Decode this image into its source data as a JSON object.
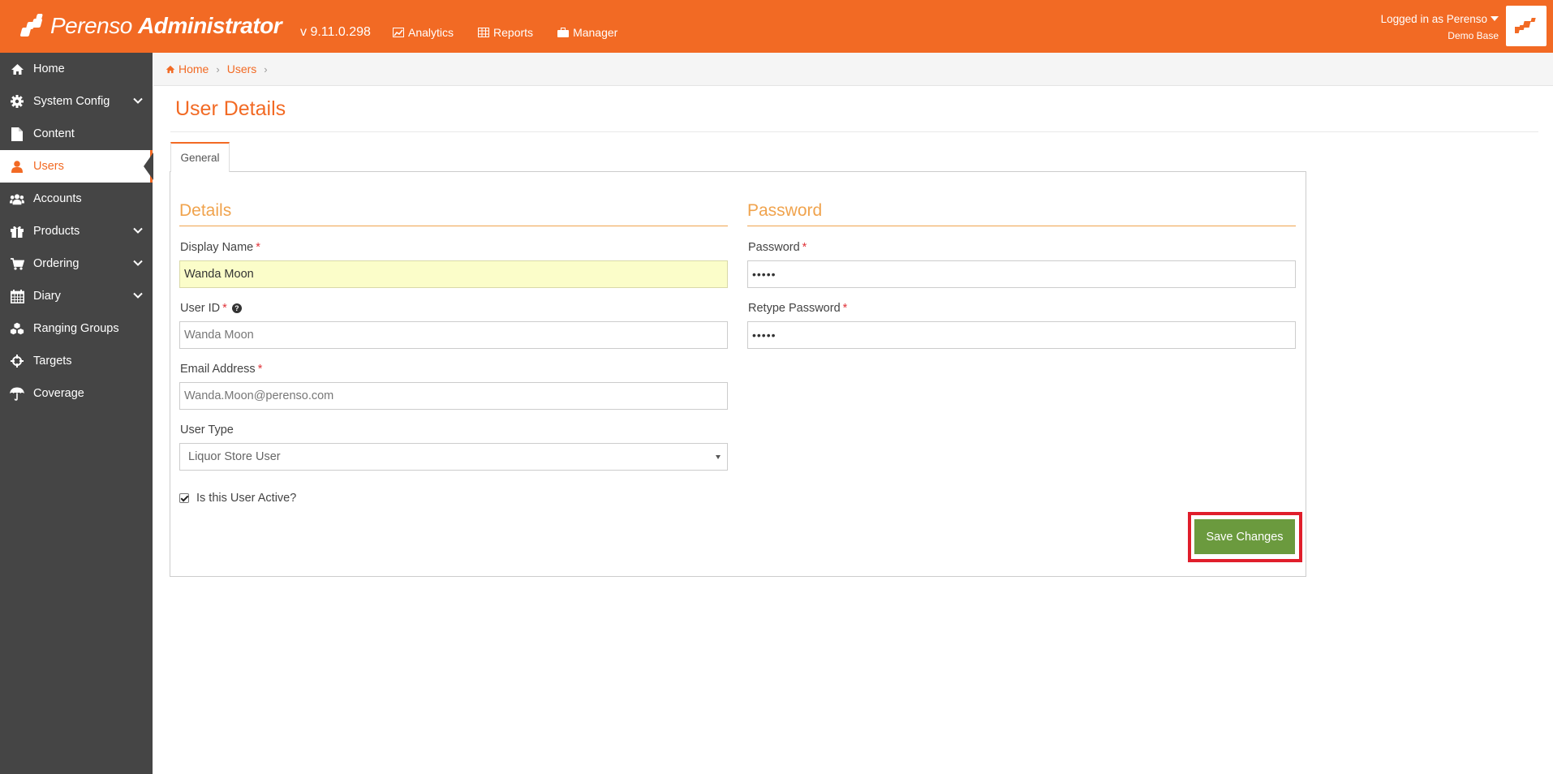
{
  "header": {
    "logo_text": "Perenso",
    "logo_bold": "Administrator",
    "version": "v 9.11.0.298",
    "nav": [
      {
        "label": "Analytics",
        "icon": "chart-icon"
      },
      {
        "label": "Reports",
        "icon": "table-icon"
      },
      {
        "label": "Manager",
        "icon": "briefcase-icon"
      }
    ],
    "login_text": "Logged in as Perenso",
    "database": "Demo Base"
  },
  "sidebar": {
    "items": [
      {
        "label": "Home",
        "icon": "home-icon"
      },
      {
        "label": "System Config",
        "icon": "gear-icon",
        "expandable": true
      },
      {
        "label": "Content",
        "icon": "file-icon"
      },
      {
        "label": "Users",
        "icon": "user-icon",
        "active": true
      },
      {
        "label": "Accounts",
        "icon": "users-icon"
      },
      {
        "label": "Products",
        "icon": "gift-icon",
        "expandable": true
      },
      {
        "label": "Ordering",
        "icon": "cart-icon",
        "expandable": true
      },
      {
        "label": "Diary",
        "icon": "calendar-icon",
        "expandable": true
      },
      {
        "label": "Ranging Groups",
        "icon": "cubes-icon"
      },
      {
        "label": "Targets",
        "icon": "crosshairs-icon"
      },
      {
        "label": "Coverage",
        "icon": "umbrella-icon"
      }
    ]
  },
  "breadcrumb": {
    "home": "Home",
    "current": "Users"
  },
  "page": {
    "title": "User Details"
  },
  "tabs": [
    {
      "label": "General"
    }
  ],
  "details": {
    "section_title": "Details",
    "display_name_label": "Display Name",
    "display_name_value": "Wanda Moon",
    "user_id_label": "User ID",
    "user_id_value": "Wanda Moon",
    "email_label": "Email Address",
    "email_value": "Wanda.Moon@perenso.com",
    "user_type_label": "User Type",
    "user_type_value": "Liquor Store User",
    "active_label": "Is this User Active?",
    "active": true
  },
  "password": {
    "section_title": "Password",
    "password_label": "Password",
    "password_value": "•••••",
    "retype_label": "Retype Password",
    "retype_value": "•••••"
  },
  "actions": {
    "save_label": "Save Changes"
  },
  "colors": {
    "brand": "#f26a24",
    "sidebar": "#454545",
    "save": "#6b9a3e",
    "highlight": "#e01e2b"
  }
}
